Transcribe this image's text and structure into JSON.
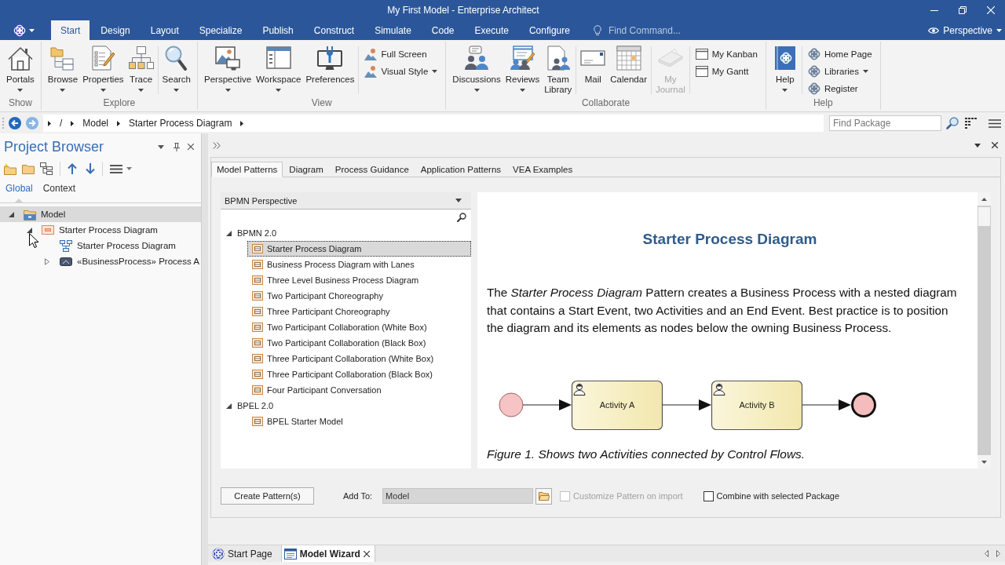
{
  "window": {
    "title": "My First Model - Enterprise Architect"
  },
  "ribbon_tabs": [
    {
      "label": "Start",
      "selected": true
    },
    {
      "label": "Design",
      "selected": false
    },
    {
      "label": "Layout",
      "selected": false
    },
    {
      "label": "Specialize",
      "selected": false
    },
    {
      "label": "Publish",
      "selected": false
    },
    {
      "label": "Construct",
      "selected": false
    },
    {
      "label": "Simulate",
      "selected": false
    },
    {
      "label": "Code",
      "selected": false
    },
    {
      "label": "Execute",
      "selected": false
    },
    {
      "label": "Configure",
      "selected": false
    }
  ],
  "command_search": {
    "placeholder": "Find Command..."
  },
  "perspective_menu": {
    "label": "Perspective"
  },
  "ribbon_groups": [
    {
      "label": "Show",
      "sections": [
        {
          "items": [
            {
              "kind": "large",
              "label": "Portals",
              "dropdown": true,
              "disabled": false
            }
          ]
        }
      ]
    },
    {
      "label": "Explore",
      "sections": [
        {
          "items": [
            {
              "kind": "large",
              "label": "Browse",
              "dropdown": true,
              "disabled": false
            },
            {
              "kind": "large",
              "label": "Properties",
              "dropdown": true,
              "disabled": false
            },
            {
              "kind": "large",
              "label": "Trace",
              "dropdown": true,
              "disabled": false
            }
          ]
        },
        {
          "items": [
            {
              "kind": "large",
              "label": "Search",
              "dropdown": true,
              "disabled": false
            }
          ]
        }
      ]
    },
    {
      "label": "View",
      "sections": [
        {
          "items": [
            {
              "kind": "large",
              "label": "Perspective",
              "dropdown": true,
              "disabled": false
            },
            {
              "kind": "large",
              "label": "Workspace",
              "dropdown": true,
              "disabled": false
            },
            {
              "kind": "large",
              "label": "Preferences",
              "dropdown": false,
              "disabled": false
            }
          ]
        },
        {
          "items": [
            {
              "kind": "small",
              "label": "Full Screen",
              "dropdown": false,
              "disabled": false
            },
            {
              "kind": "small",
              "label": "Visual Style",
              "dropdown": true,
              "disabled": false
            }
          ]
        }
      ]
    },
    {
      "label": "Collaborate",
      "sections": [
        {
          "items": [
            {
              "kind": "large",
              "label": "Discussions",
              "dropdown": true,
              "disabled": false
            },
            {
              "kind": "large",
              "label": "Reviews",
              "dropdown": true,
              "disabled": false
            },
            {
              "kind": "large",
              "label": "Team Library",
              "dropdown": false,
              "disabled": false
            }
          ]
        },
        {
          "items": [
            {
              "kind": "large",
              "label": "Mail",
              "dropdown": false,
              "disabled": false
            },
            {
              "kind": "large",
              "label": "Calendar",
              "dropdown": false,
              "disabled": false
            }
          ]
        },
        {
          "items": [
            {
              "kind": "large",
              "label": "My Journal",
              "dropdown": false,
              "disabled": true
            }
          ]
        },
        {
          "items": [
            {
              "kind": "small",
              "label": "My Kanban",
              "dropdown": false,
              "disabled": false
            },
            {
              "kind": "small",
              "label": "My Gantt",
              "dropdown": false,
              "disabled": false
            }
          ]
        }
      ]
    },
    {
      "label": "Help",
      "sections": [
        {
          "items": [
            {
              "kind": "large",
              "label": "Help",
              "dropdown": true,
              "disabled": false
            }
          ]
        },
        {
          "items": [
            {
              "kind": "small",
              "label": "Home Page",
              "dropdown": false,
              "disabled": false
            },
            {
              "kind": "small",
              "label": "Libraries",
              "dropdown": true,
              "disabled": false
            },
            {
              "kind": "small",
              "label": "Register",
              "dropdown": false,
              "disabled": false
            }
          ]
        }
      ]
    }
  ],
  "breadcrumb": [
    "/",
    "Model",
    "Starter Process Diagram"
  ],
  "package_search": {
    "placeholder": "Find Package"
  },
  "project_browser": {
    "title": "Project Browser",
    "tabs": [
      {
        "label": "Global",
        "selected": true
      },
      {
        "label": "Context",
        "selected": false
      }
    ],
    "tree": [
      {
        "kind": "model",
        "label": "Model",
        "expandable": true,
        "expanded": true,
        "selected": true,
        "children": [
          {
            "kind": "package",
            "label": "Starter Process Diagram",
            "expandable": true,
            "expanded": true,
            "selected": false,
            "children": [
              {
                "kind": "diagram",
                "label": "Starter Process Diagram",
                "expandable": false,
                "selected": false
              },
              {
                "kind": "process",
                "label": "«BusinessProcess» Process A",
                "expandable": true,
                "expanded": false,
                "selected": false
              }
            ]
          }
        ]
      }
    ]
  },
  "wizard": {
    "tabs": [
      {
        "label": "Model Patterns",
        "selected": true
      },
      {
        "label": "Diagram",
        "selected": false
      },
      {
        "label": "Process Guidance",
        "selected": false
      },
      {
        "label": "Application Patterns",
        "selected": false
      },
      {
        "label": "VEA Examples",
        "selected": false
      }
    ],
    "perspective_select": {
      "value": "BPMN Perspective"
    },
    "pattern_groups": [
      {
        "label": "BPMN 2.0",
        "expanded": true,
        "patterns": [
          {
            "label": "Starter Process Diagram",
            "selected": true
          },
          {
            "label": "Business Process Diagram with Lanes",
            "selected": false
          },
          {
            "label": "Three Level Business Process Diagram",
            "selected": false
          },
          {
            "label": "Two Participant Choreography",
            "selected": false
          },
          {
            "label": "Three Participant Choreography",
            "selected": false
          },
          {
            "label": "Two Participant Collaboration (White Box)",
            "selected": false
          },
          {
            "label": "Two Participant Collaboration (Black Box)",
            "selected": false
          },
          {
            "label": "Three Participant Collaboration (White Box)",
            "selected": false
          },
          {
            "label": "Three Participant Collaboration (Black Box)",
            "selected": false
          },
          {
            "label": "Four Participant Conversation",
            "selected": false
          }
        ]
      },
      {
        "label": "BPEL 2.0",
        "expanded": true,
        "patterns": [
          {
            "label": "BPEL Starter Model",
            "selected": false
          }
        ]
      }
    ],
    "preview": {
      "title": "Starter Process Diagram",
      "paragraph": "The *Starter Process Diagram* Pattern creates a Business Process with a nested diagram that contains a Start Event, two Activities and an End Event. Best practice is to position the diagram and its elements as nodes below the owning Business Process.",
      "diagram_nodes": [
        {
          "kind": "start_event"
        },
        {
          "kind": "activity",
          "label": "Activity A"
        },
        {
          "kind": "activity",
          "label": "Activity B"
        },
        {
          "kind": "end_event"
        }
      ],
      "caption": "Figure 1. Shows two Activities connected by Control Flows."
    },
    "create_button": {
      "label": "Create Pattern(s)"
    },
    "add_to": {
      "label": "Add To:",
      "value": "Model",
      "disabled": true
    },
    "options": [
      {
        "label": "Customize Pattern on import",
        "checked": false,
        "disabled": true
      },
      {
        "label": "Combine with selected Package",
        "checked": false,
        "disabled": false
      }
    ]
  },
  "document_tabs": [
    {
      "kind": "start_page",
      "label": "Start Page",
      "selected": false,
      "closable": false
    },
    {
      "kind": "wizard",
      "label": "Model Wizard",
      "selected": true,
      "closable": true
    }
  ]
}
